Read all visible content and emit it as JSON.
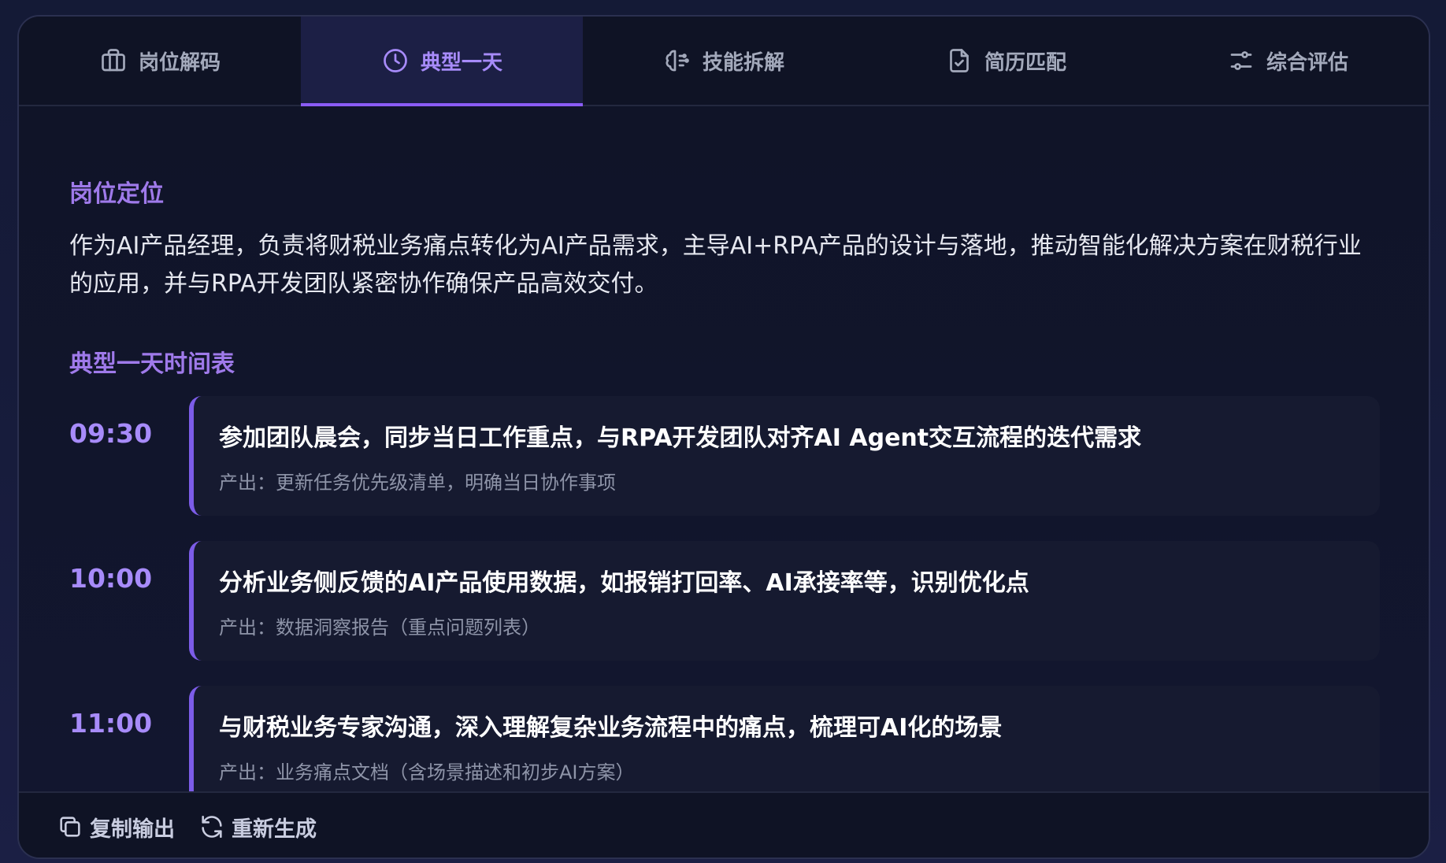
{
  "tabs": [
    {
      "label": "岗位解码",
      "icon": "briefcase-icon",
      "active": false
    },
    {
      "label": "典型一天",
      "icon": "clock-icon",
      "active": true
    },
    {
      "label": "技能拆解",
      "icon": "brain-icon",
      "active": false
    },
    {
      "label": "简历匹配",
      "icon": "file-check-icon",
      "active": false
    },
    {
      "label": "综合评估",
      "icon": "sliders-icon",
      "active": false
    }
  ],
  "positioning": {
    "title": "岗位定位",
    "text": "作为AI产品经理，负责将财税业务痛点转化为AI产品需求，主导AI+RPA产品的设计与落地，推动智能化解决方案在财税行业的应用，并与RPA开发团队紧密协作确保产品高效交付。"
  },
  "schedule": {
    "title": "典型一天时间表",
    "items": [
      {
        "time": "09:30",
        "title": "参加团队晨会，同步当日工作重点，与RPA开发团队对齐AI Agent交互流程的迭代需求",
        "output": "产出：更新任务优先级清单，明确当日协作事项"
      },
      {
        "time": "10:00",
        "title": "分析业务侧反馈的AI产品使用数据，如报销打回率、AI承接率等，识别优化点",
        "output": "产出：数据洞察报告（重点问题列表）"
      },
      {
        "time": "11:00",
        "title": "与财税业务专家沟通，深入理解复杂业务流程中的痛点，梳理可AI化的场景",
        "output": "产出：业务痛点文档（含场景描述和初步AI方案）"
      }
    ]
  },
  "footer": {
    "copy_label": "复制输出",
    "regen_label": "重新生成"
  },
  "colors": {
    "accent": "#a78bfa",
    "active_tab_bg": "#1c1f45",
    "card_border": "#7c5ce8"
  }
}
